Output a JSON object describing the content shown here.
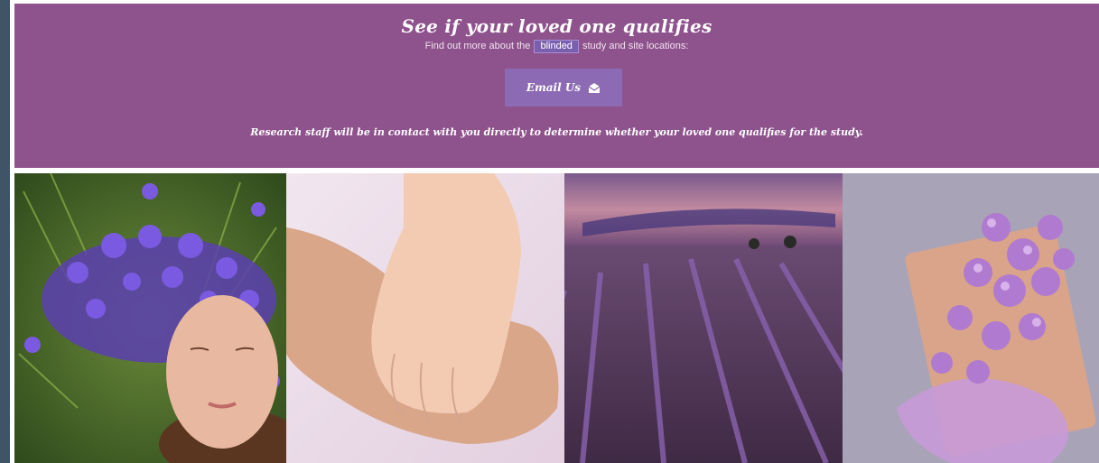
{
  "hero": {
    "title": "See if your loved one qualifies",
    "subtitle_before": "Find out more about the",
    "subtitle_highlight": "blinded",
    "subtitle_after": "study and site locations:",
    "email_button_label": "Email Us",
    "note": "Research staff will be in contact with you directly to determine whether your loved one qualifies for the study."
  },
  "colors": {
    "hero_bg": "#8e528c",
    "button_bg": "#8d6bb4",
    "left_bar": "#3f5567"
  },
  "gallery": {
    "photos": [
      {
        "subject": "woman-with-flower-crown"
      },
      {
        "subject": "holding-hands"
      },
      {
        "subject": "lavender-field-at-sunset"
      },
      {
        "subject": "lilac-bouquet-gift"
      }
    ]
  }
}
